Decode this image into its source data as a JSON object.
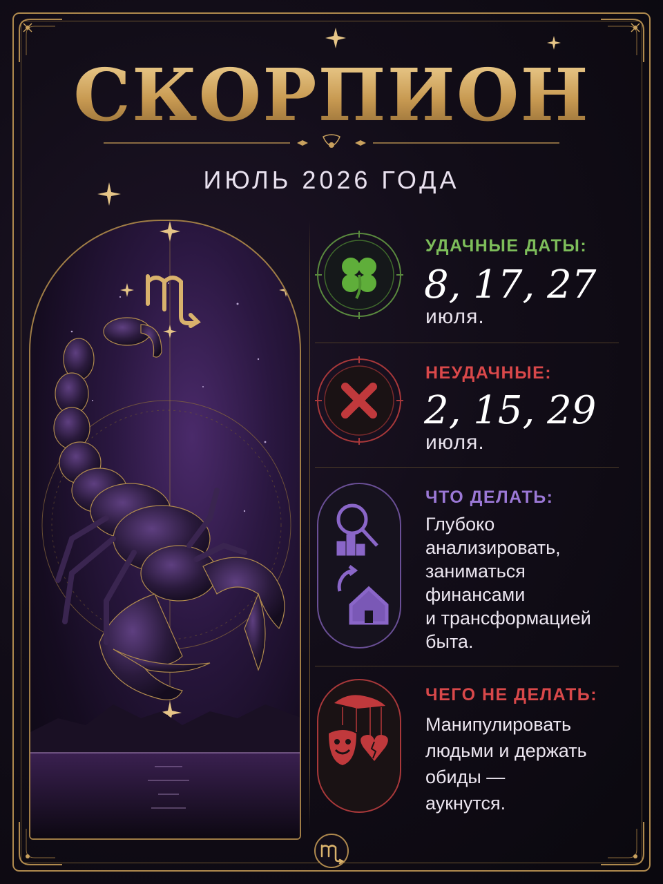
{
  "title": "СКОРПИОН",
  "subtitle": "ИЮЛЬ 2026 ГОДА",
  "symbol_icon": "scorpio-glyph-icon",
  "colors": {
    "gold": "#d9b26c",
    "lucky": "#7dbd5a",
    "unlucky": "#d9484a",
    "todo": "#9b78d6",
    "avoid": "#d9484a"
  },
  "lucky": {
    "label": "УДАЧНЫЕ ДАТЫ:",
    "dates": "8, 17, 27",
    "month": "июля.",
    "icon": "four-leaf-clover-icon"
  },
  "unlucky": {
    "label": "НЕУДАЧНЫЕ:",
    "dates": "2, 15, 29",
    "month": "июля.",
    "icon": "cross-icon"
  },
  "todo": {
    "label": "ЧТО ДЕЛАТЬ:",
    "lines": [
      "Глубоко",
      "анализировать,",
      "заниматься",
      "финансами",
      "и трансформацией",
      "быта."
    ],
    "icon": "analysis-and-home-icon"
  },
  "avoid": {
    "label": "ЧЕГО НЕ ДЕЛАТЬ:",
    "lines": [
      "Манипулировать",
      "людьми и держать",
      "обиды —",
      "аукнутся."
    ],
    "icon": "puppet-masks-broken-heart-icon"
  }
}
